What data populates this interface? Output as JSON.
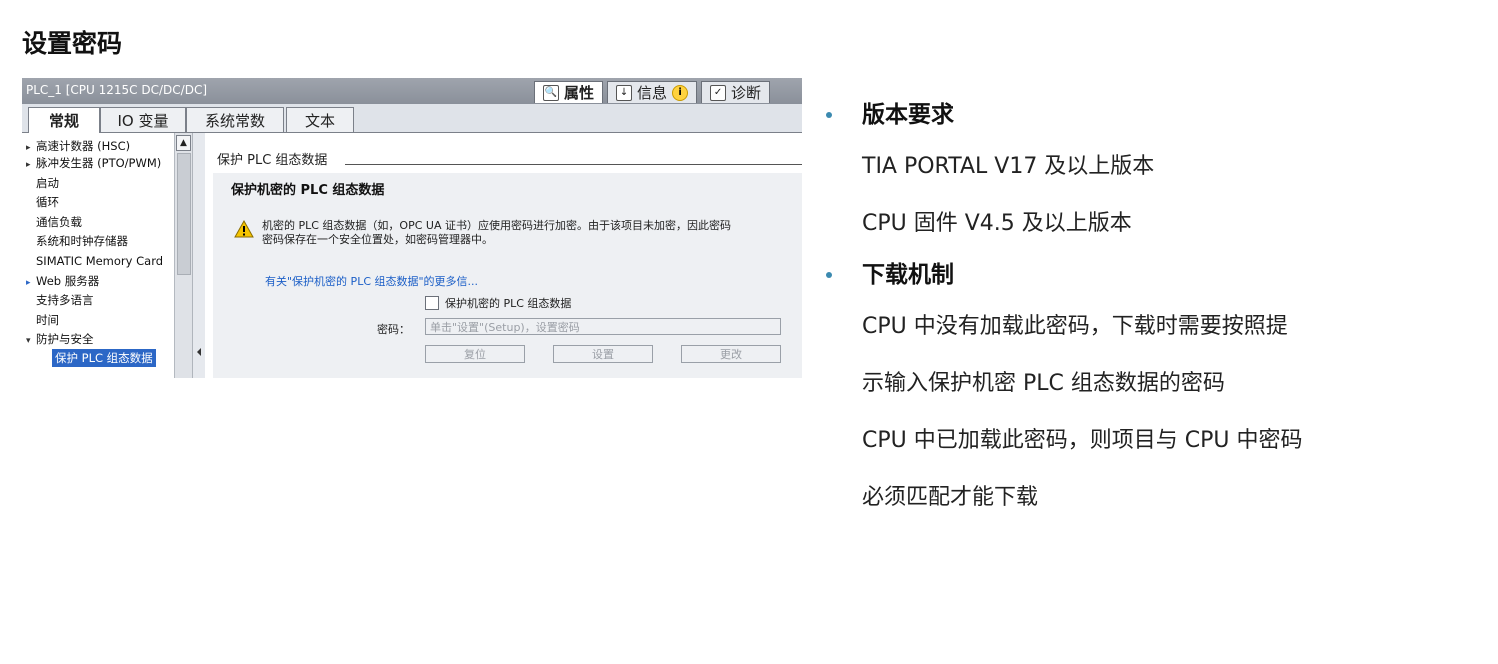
{
  "slide": {
    "title": "设置密码"
  },
  "window": {
    "title": "PLC_1 [CPU 1215C DC/DC/DC]",
    "inspector_tabs": [
      {
        "label": "属性",
        "icon": "properties-icon"
      },
      {
        "label": "信息",
        "icon": "info-icon"
      },
      {
        "label": "诊断",
        "icon": "diagnostics-icon"
      }
    ],
    "tabs": [
      "常规",
      "IO 变量",
      "系统常数",
      "文本"
    ],
    "nav": [
      {
        "label": "高速计数器 (HSC)",
        "arrow": "▸"
      },
      {
        "label": "脉冲发生器 (PTO/PWM)",
        "arrow": "▸"
      },
      {
        "label": "启动",
        "arrow": ""
      },
      {
        "label": "循环",
        "arrow": ""
      },
      {
        "label": "通信负载",
        "arrow": ""
      },
      {
        "label": "系统和时钟存储器",
        "arrow": ""
      },
      {
        "label": "SIMATIC Memory Card",
        "arrow": ""
      },
      {
        "label": "Web 服务器",
        "arrow": "▸"
      },
      {
        "label": "支持多语言",
        "arrow": ""
      },
      {
        "label": "时间",
        "arrow": ""
      },
      {
        "label": "防护与安全",
        "arrow": "▾"
      },
      {
        "label": "保护 PLC 组态数据",
        "arrow": ""
      }
    ],
    "section": {
      "header": "保护 PLC 组态数据",
      "panel_title": "保护机密的 PLC 组态数据",
      "warning_line1": "机密的 PLC 组态数据（如，OPC UA 证书）应使用密码进行加密。由于该项目未加密，因此密码",
      "warning_line2": "密码保存在一个安全位置处，如密码管理器中。",
      "more_link": "有关\"保护机密的 PLC 组态数据\"的更多信...",
      "checkbox_label": "保护机密的 PLC 组态数据",
      "password_label": "密码：",
      "password_placeholder": "单击\"设置\"(Setup)，设置密码",
      "buttons": {
        "reset": "复位",
        "set": "设置",
        "change": "更改"
      }
    }
  },
  "requirements": [
    {
      "title": "版本要求",
      "lines": [
        "TIA PORTAL V17 及以上版本",
        "CPU 固件 V4.5 及以上版本"
      ]
    },
    {
      "title": "下载机制",
      "lines": [
        "CPU 中没有加载此密码，下载时需要按照提",
        "示输入保护机密 PLC 组态数据的密码",
        "CPU 中已加载此密码，则项目与 CPU 中密码",
        "必须匹配才能下载"
      ]
    }
  ]
}
